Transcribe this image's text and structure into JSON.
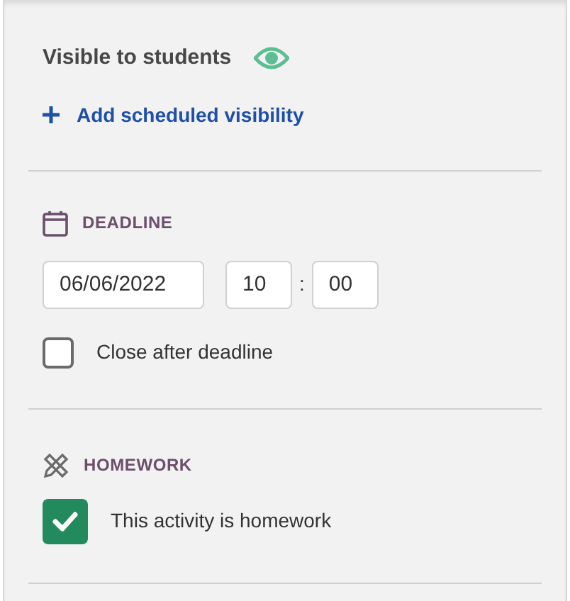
{
  "visibility": {
    "title": "Visible to students",
    "visible": true,
    "add_link": "Add scheduled visibility"
  },
  "deadline": {
    "heading": "DEADLINE",
    "date": "06/06/2022",
    "hour": "10",
    "separator": ":",
    "minute": "00",
    "close_after": {
      "label": "Close after deadline",
      "checked": false
    }
  },
  "homework": {
    "heading": "HOMEWORK",
    "option": {
      "label": "This activity is homework",
      "checked": true
    }
  }
}
